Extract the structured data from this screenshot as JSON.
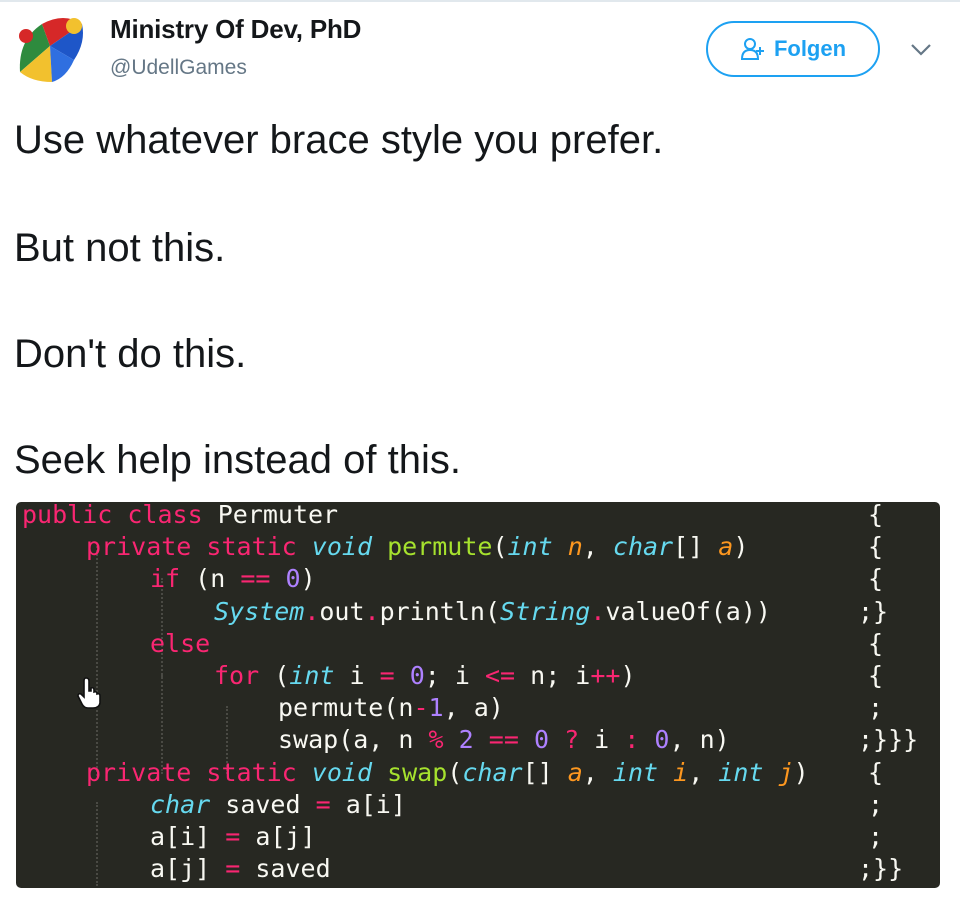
{
  "tweet": {
    "author_name": "Ministry Of Dev, PhD",
    "author_handle": "@UdellGames",
    "follow_label": "Folgen",
    "lines": [
      "Use whatever brace style you prefer.",
      "But not this.",
      "Don't do this.",
      "Seek help instead of this."
    ]
  },
  "icons": {
    "avatar": "jester-hat-avatar",
    "follow": "add-person-icon",
    "menu": "chevron-down-icon",
    "cursor": "hand-pointer-icon"
  },
  "code": {
    "lines": [
      {
        "tokens": [
          [
            "kw",
            "public"
          ],
          [
            "tx",
            " "
          ],
          [
            "kw",
            "class"
          ],
          [
            "tx",
            " Permuter"
          ]
        ],
        "brace": "{"
      },
      {
        "tokens": [
          [
            "kw",
            "private"
          ],
          [
            "tx",
            " "
          ],
          [
            "kw",
            "static"
          ],
          [
            "tx",
            " "
          ],
          [
            "ty",
            "void"
          ],
          [
            "tx",
            " "
          ],
          [
            "fn",
            "permute"
          ],
          [
            "tx",
            "("
          ],
          [
            "ty",
            "int"
          ],
          [
            "tx",
            " "
          ],
          [
            "pa",
            "n"
          ],
          [
            "tx",
            ", "
          ],
          [
            "ty",
            "char"
          ],
          [
            "tx",
            "[] "
          ],
          [
            "pa",
            "a"
          ],
          [
            "tx",
            ")"
          ]
        ],
        "brace": "{"
      },
      {
        "tokens": [
          [
            "kw",
            "if"
          ],
          [
            "tx",
            " (n "
          ],
          [
            "op",
            "=="
          ],
          [
            "tx",
            " "
          ],
          [
            "nm",
            "0"
          ],
          [
            "tx",
            ")"
          ]
        ],
        "brace": "{"
      },
      {
        "tokens": [
          [
            "ty",
            "System"
          ],
          [
            "op",
            "."
          ],
          [
            "tx",
            "out"
          ],
          [
            "op",
            "."
          ],
          [
            "tx",
            "println("
          ],
          [
            "ty",
            "String"
          ],
          [
            "op",
            "."
          ],
          [
            "tx",
            "valueOf(a))"
          ]
        ],
        "brace": ";}"
      },
      {
        "tokens": [
          [
            "kw",
            "else"
          ]
        ],
        "brace": "{"
      },
      {
        "tokens": [
          [
            "kw",
            "for"
          ],
          [
            "tx",
            " ("
          ],
          [
            "ty",
            "int"
          ],
          [
            "tx",
            " i "
          ],
          [
            "op",
            "="
          ],
          [
            "tx",
            " "
          ],
          [
            "nm",
            "0"
          ],
          [
            "tx",
            "; i "
          ],
          [
            "op",
            "<="
          ],
          [
            "tx",
            " n; i"
          ],
          [
            "op",
            "++"
          ],
          [
            "tx",
            ")"
          ]
        ],
        "brace": "{"
      },
      {
        "tokens": [
          [
            "tx",
            "permute(n"
          ],
          [
            "op",
            "-"
          ],
          [
            "nm",
            "1"
          ],
          [
            "tx",
            ", a)"
          ]
        ],
        "brace": ";"
      },
      {
        "tokens": [
          [
            "tx",
            "swap(a, n "
          ],
          [
            "op",
            "%"
          ],
          [
            "tx",
            " "
          ],
          [
            "nm",
            "2"
          ],
          [
            "tx",
            " "
          ],
          [
            "op",
            "=="
          ],
          [
            "tx",
            " "
          ],
          [
            "nm",
            "0"
          ],
          [
            "tx",
            " "
          ],
          [
            "op",
            "?"
          ],
          [
            "tx",
            " i "
          ],
          [
            "op",
            ":"
          ],
          [
            "tx",
            " "
          ],
          [
            "nm",
            "0"
          ],
          [
            "tx",
            ", n)"
          ]
        ],
        "brace": ";}}}"
      },
      {
        "tokens": [
          [
            "kw",
            "private"
          ],
          [
            "tx",
            " "
          ],
          [
            "kw",
            "static"
          ],
          [
            "tx",
            " "
          ],
          [
            "ty",
            "void"
          ],
          [
            "tx",
            " "
          ],
          [
            "fn",
            "swap"
          ],
          [
            "tx",
            "("
          ],
          [
            "ty",
            "char"
          ],
          [
            "tx",
            "[] "
          ],
          [
            "pa",
            "a"
          ],
          [
            "tx",
            ", "
          ],
          [
            "ty",
            "int"
          ],
          [
            "tx",
            " "
          ],
          [
            "pa",
            "i"
          ],
          [
            "tx",
            ", "
          ],
          [
            "ty",
            "int"
          ],
          [
            "tx",
            " "
          ],
          [
            "pa",
            "j"
          ],
          [
            "tx",
            ")"
          ]
        ],
        "brace": "{"
      },
      {
        "tokens": [
          [
            "ty",
            "char"
          ],
          [
            "tx",
            " saved "
          ],
          [
            "op",
            "="
          ],
          [
            "tx",
            " a[i]"
          ]
        ],
        "brace": ";"
      },
      {
        "tokens": [
          [
            "tx",
            "a[i] "
          ],
          [
            "op",
            "="
          ],
          [
            "tx",
            " a[j]"
          ]
        ],
        "brace": ";"
      },
      {
        "tokens": [
          [
            "tx",
            "a[j] "
          ],
          [
            "op",
            "="
          ],
          [
            "tx",
            " saved"
          ]
        ],
        "brace": ";}}"
      }
    ]
  }
}
